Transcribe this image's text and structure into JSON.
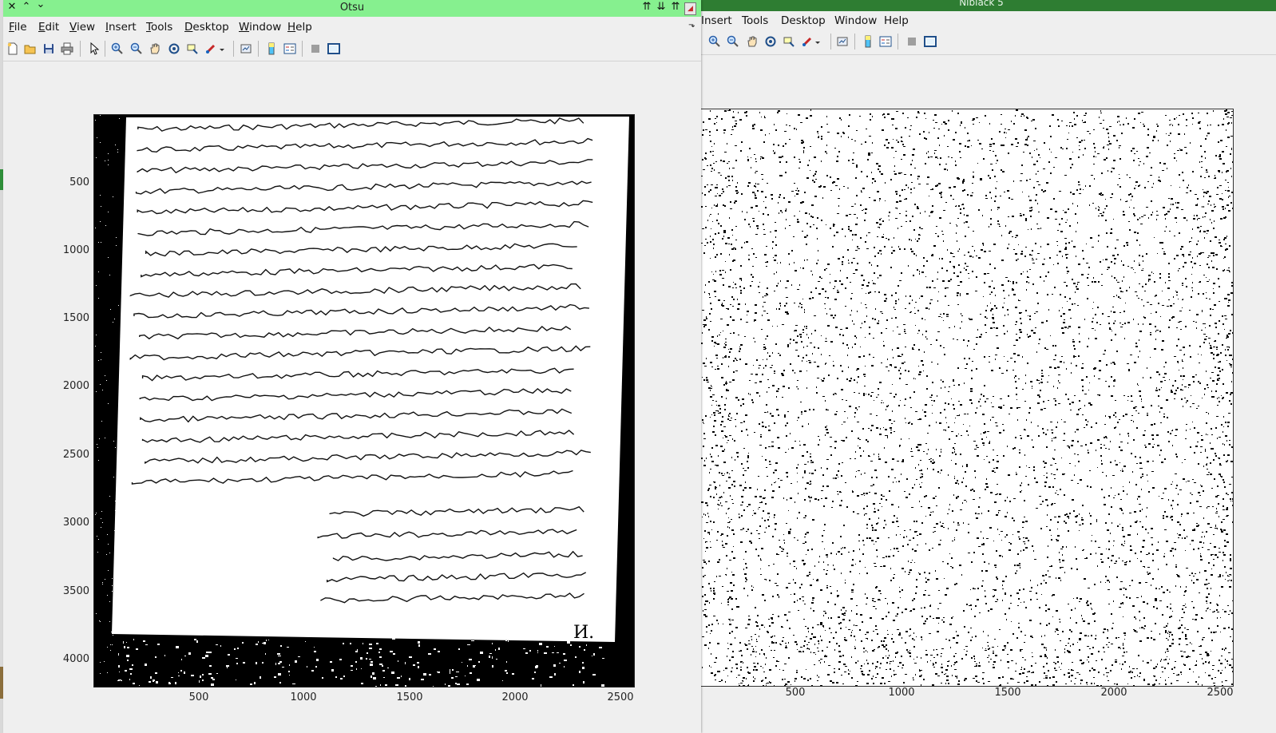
{
  "desktop": {},
  "niblack_window": {
    "title": "Niblack 5",
    "menu": [
      "Insert",
      "Tools",
      "Desktop",
      "Window",
      "Help"
    ],
    "axes": {
      "x_ticks": [
        "500",
        "1000",
        "1500",
        "2000",
        "2500"
      ]
    }
  },
  "otsu_window": {
    "title": "Otsu",
    "menu": [
      "File",
      "Edit",
      "View",
      "Insert",
      "Tools",
      "Desktop",
      "Window",
      "Help"
    ],
    "menu_mnemonics": [
      "F",
      "E",
      "V",
      "I",
      "T",
      "D",
      "W",
      "H"
    ],
    "toolbar_icons": [
      "new-figure-icon",
      "open-file-icon",
      "save-icon",
      "print-icon",
      "pointer-icon",
      "zoom-in-icon",
      "zoom-out-icon",
      "pan-icon",
      "rotate-icon",
      "data-cursor-icon",
      "brush-icon",
      "brush-dropdown-icon",
      "link-plot-icon",
      "colorbar-icon",
      "legend-icon",
      "hide-plot-tools-icon",
      "show-plot-tools-icon"
    ],
    "axes": {
      "y_ticks": [
        "500",
        "1000",
        "1500",
        "2000",
        "2500",
        "3000",
        "3500",
        "4000"
      ],
      "x_ticks": [
        "500",
        "1000",
        "1500",
        "2000",
        "2500"
      ],
      "document_mark": "И."
    }
  }
}
